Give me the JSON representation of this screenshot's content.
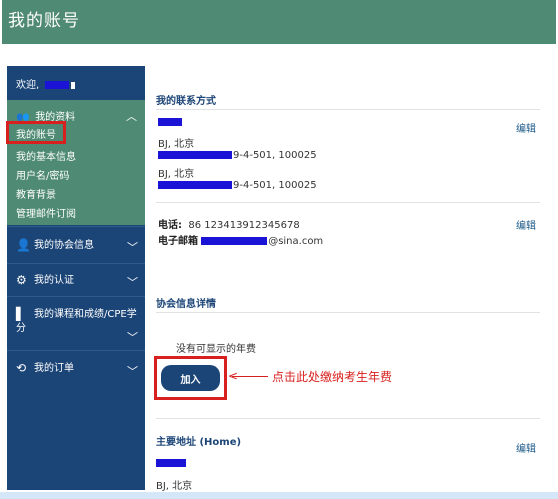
{
  "header": {
    "title": "我的账号"
  },
  "sidebar": {
    "welcome": "欢迎,",
    "profile": {
      "label": "我的资料",
      "items": [
        "我的账号",
        "我的基本信息",
        "用户名/密码",
        "教育背景",
        "管理邮件订阅"
      ]
    },
    "menu": [
      {
        "label": "我的协会信息",
        "icon": "user-icon"
      },
      {
        "label": "我的认证",
        "icon": "gear-icon"
      },
      {
        "label": "我的课程和成绩/CPE学分",
        "icon": "book-icon"
      },
      {
        "label": "我的订单",
        "icon": "history-icon"
      }
    ]
  },
  "main": {
    "contact": {
      "title": "我的联系方式",
      "edit_label": "编辑",
      "addr1_city": "BJ, 北京",
      "addr1_line": "9-4-501, 100025",
      "addr2_city": "BJ, 北京",
      "addr2_line": "9-4-501, 100025",
      "phone_label": "电话:",
      "phone_value": "86 123413912345678",
      "email_label": "电子邮箱",
      "email_value": "@sina.com",
      "edit2_label": "编辑"
    },
    "membership": {
      "title": "协会信息详情",
      "empty_text": "没有可显示的年费",
      "join_label": "加入",
      "annotation": "点击此处缴纳考生年费"
    },
    "primary_address": {
      "title": "主要地址 (Home)",
      "edit_label": "编辑",
      "city": "BJ, 北京"
    }
  },
  "colors": {
    "header_bg": "#4f8a74",
    "sidebar_bg": "#1c4577",
    "highlight_red": "#d8201e",
    "redaction": "#1b14d6"
  }
}
